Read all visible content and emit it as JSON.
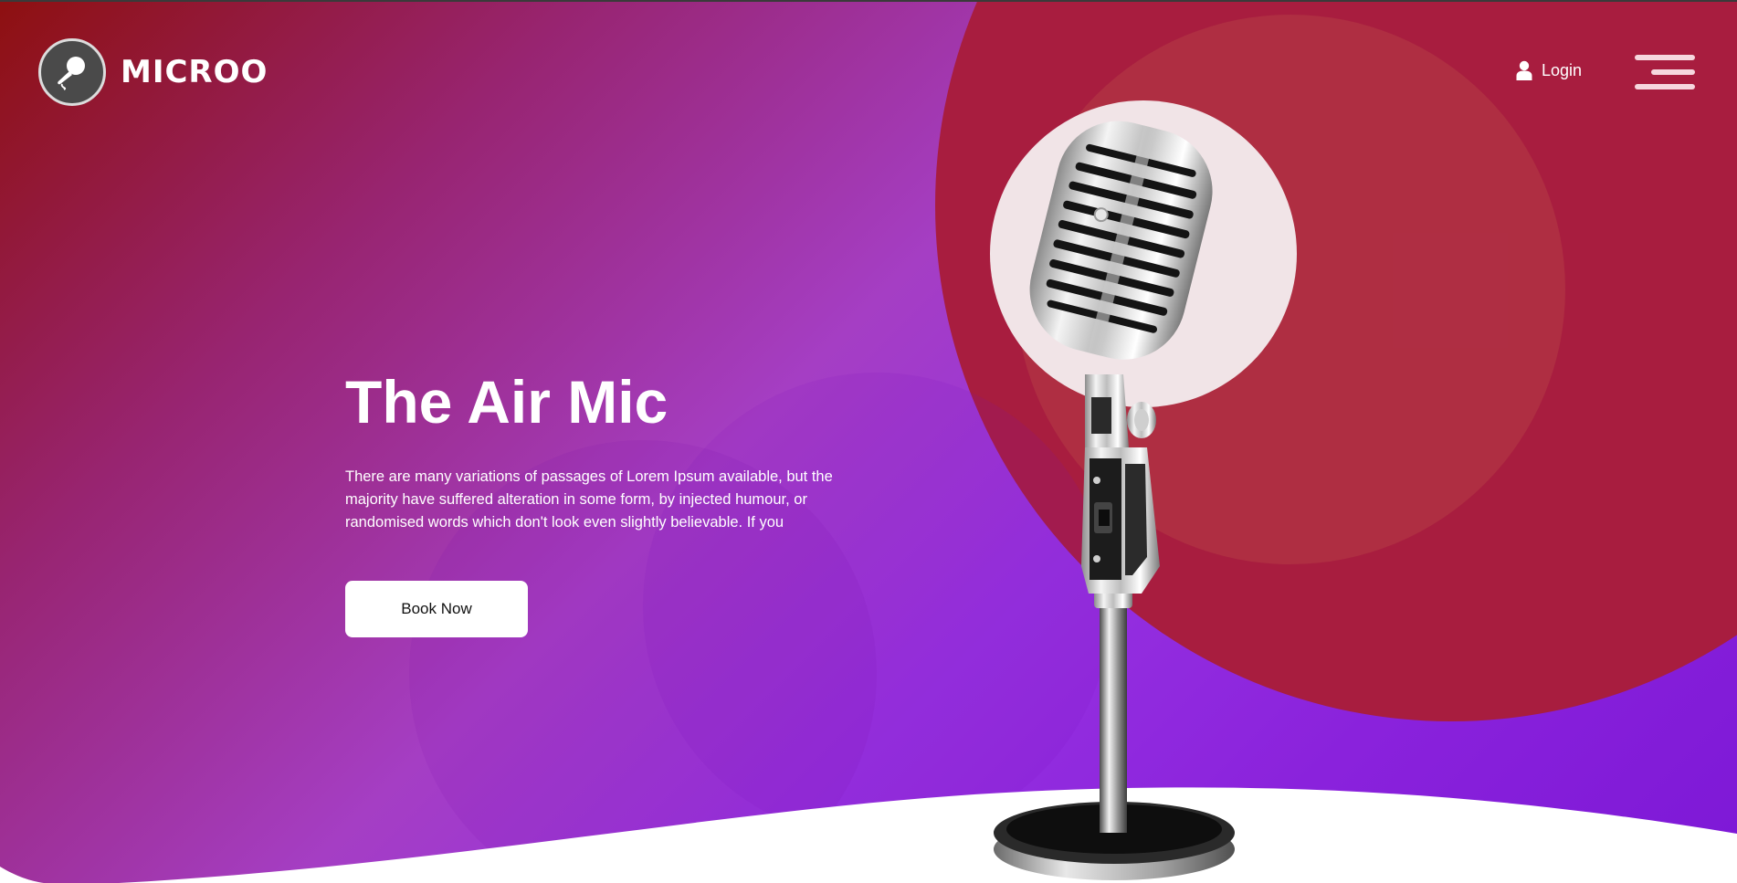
{
  "brand": {
    "name": "MICROO",
    "logo_icon": "microphone-logo-icon"
  },
  "nav": {
    "login_label": "Login",
    "login_icon": "user-icon",
    "menu_icon": "hamburger-menu-icon"
  },
  "hero": {
    "title": "The Air Mic",
    "description": "There are many variations of passages of Lorem Ipsum available, but the majority have suffered alteration in some form, by injected humour, or randomised words which don't look even slightly believable. If you",
    "cta_label": "Book Now",
    "image": "vintage-microphone-image"
  },
  "colors": {
    "gradient_start": "#8e1010",
    "gradient_mid": "#a53ec4",
    "gradient_end": "#7d18d6",
    "blob": "#a81d3f",
    "button_bg": "#ffffff",
    "menu_lines": "#f6d7de"
  }
}
